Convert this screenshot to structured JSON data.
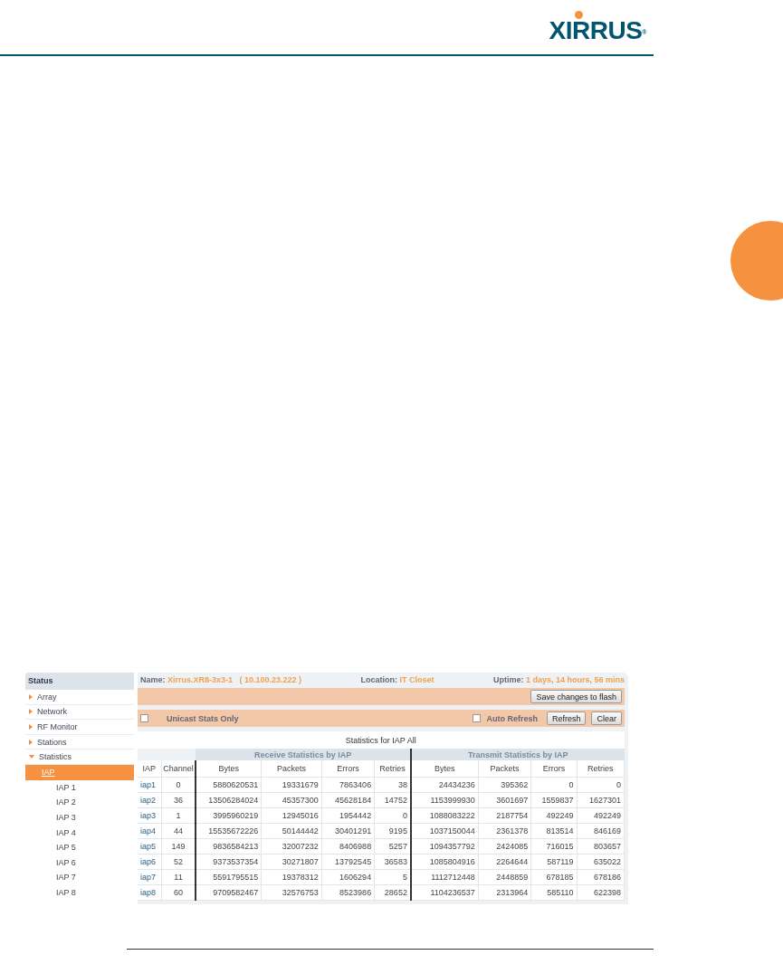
{
  "logo": {
    "text": "XIRRUS",
    "mark": "®"
  },
  "sidebar": {
    "title": "Status",
    "items": [
      {
        "label": "Array",
        "expanded": false,
        "selected": false
      },
      {
        "label": "Network",
        "expanded": false,
        "selected": false
      },
      {
        "label": "RF Monitor",
        "expanded": false,
        "selected": false
      },
      {
        "label": "Stations",
        "expanded": false,
        "selected": false
      },
      {
        "label": "Statistics",
        "expanded": true,
        "selected": false,
        "children": [
          {
            "label": "IAP",
            "selected": true
          },
          {
            "label": "IAP 1",
            "selected": false
          },
          {
            "label": "IAP 2",
            "selected": false
          },
          {
            "label": "IAP 3",
            "selected": false
          },
          {
            "label": "IAP 4",
            "selected": false
          },
          {
            "label": "IAP 5",
            "selected": false
          },
          {
            "label": "IAP 6",
            "selected": false
          },
          {
            "label": "IAP 7",
            "selected": false
          },
          {
            "label": "IAP 8",
            "selected": false
          }
        ]
      }
    ]
  },
  "info": [
    {
      "label": "Name:",
      "value": "Xirrus.XR8-3x3-1   ( 10.100.23.222 )"
    },
    {
      "label": "Location:",
      "value": "IT Closet"
    },
    {
      "label": "Uptime:",
      "value": "1 days, 14 hours, 56 mins"
    }
  ],
  "save_button": "Save changes to flash",
  "options": {
    "unicast": {
      "label": "Unicast Stats Only",
      "checked": false
    },
    "auto_refresh": {
      "label": "Auto Refresh",
      "checked": false
    },
    "buttons": [
      "Refresh",
      "Clear"
    ]
  },
  "table": {
    "title": "Statistics for IAP All",
    "groups": [
      "Receive Statistics by IAP",
      "Transmit Statistics by IAP"
    ],
    "columns": [
      "IAP",
      "Channel",
      "Bytes",
      "Packets",
      "Errors",
      "Retries",
      "Bytes",
      "Packets",
      "Errors",
      "Retries"
    ],
    "rows": [
      [
        "iap1",
        "0",
        "5880620531",
        "19331679",
        "7863406",
        "38",
        "24434236",
        "395362",
        "0",
        "0"
      ],
      [
        "iap2",
        "36",
        "13506284024",
        "45357300",
        "45628184",
        "14752",
        "1153999930",
        "3601697",
        "1559837",
        "1627301"
      ],
      [
        "iap3",
        "1",
        "3995960219",
        "12945016",
        "1954442",
        "0",
        "1088083222",
        "2187754",
        "492249",
        "492249"
      ],
      [
        "iap4",
        "44",
        "15535672226",
        "50144442",
        "30401291",
        "9195",
        "1037150044",
        "2361378",
        "813514",
        "846169"
      ],
      [
        "iap5",
        "149",
        "9836584213",
        "32007232",
        "8406988",
        "5257",
        "1094357792",
        "2424085",
        "716015",
        "803657"
      ],
      [
        "iap6",
        "52",
        "9373537354",
        "30271807",
        "13792545",
        "36583",
        "1085804916",
        "2264644",
        "587119",
        "635022"
      ],
      [
        "iap7",
        "11",
        "5591795515",
        "19378312",
        "1606294",
        "5",
        "1112712448",
        "2448859",
        "678185",
        "678186"
      ],
      [
        "iap8",
        "60",
        "9709582467",
        "32576753",
        "8523986",
        "28652",
        "1104236537",
        "2313964",
        "585110",
        "622398"
      ]
    ]
  }
}
